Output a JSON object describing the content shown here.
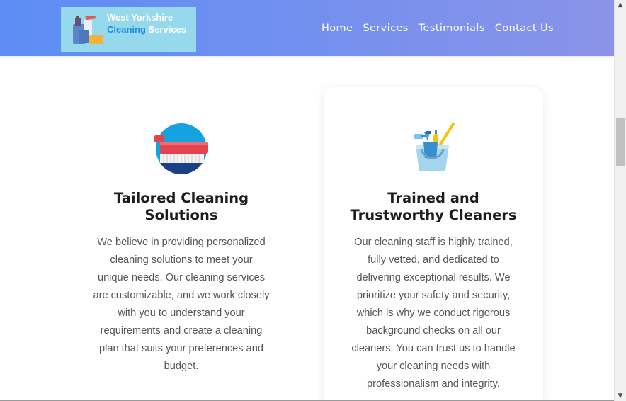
{
  "header": {
    "logo": {
      "line1": "West Yorkshire",
      "line2a": "Cleaning",
      "line2b": "Services"
    },
    "nav": [
      "Home",
      "Services",
      "Testimonials",
      "Contact Us"
    ]
  },
  "cards": [
    {
      "icon": "scrub-brush-icon",
      "title_line1": "Tailored Cleaning",
      "title_line2": "Solutions",
      "desc_lines": [
        "We believe in providing personalized",
        "cleaning solutions to meet your",
        "unique needs. Our cleaning services",
        "are customizable, and we work closely",
        "with you to understand your",
        "requirements and create a cleaning",
        "plan that suits your preferences and",
        "budget."
      ]
    },
    {
      "icon": "cleaning-bucket-icon",
      "title_line1": "Trained and",
      "title_line2": "Trustworthy Cleaners",
      "desc_lines": [
        "Our cleaning staff is highly trained,",
        "fully vetted, and dedicated to",
        "delivering exceptional results. We",
        "prioritize your safety and security,",
        "which is why we conduct rigorous",
        "background checks on all our",
        "cleaners. You can trust us to handle",
        "your cleaning needs with",
        "professionalism and integrity."
      ]
    }
  ],
  "colors": {
    "header_start": "#5c8df5",
    "header_end": "#8a93e8",
    "logo_bg": "#97d9ec",
    "logo_blue": "#1c8fe0"
  }
}
